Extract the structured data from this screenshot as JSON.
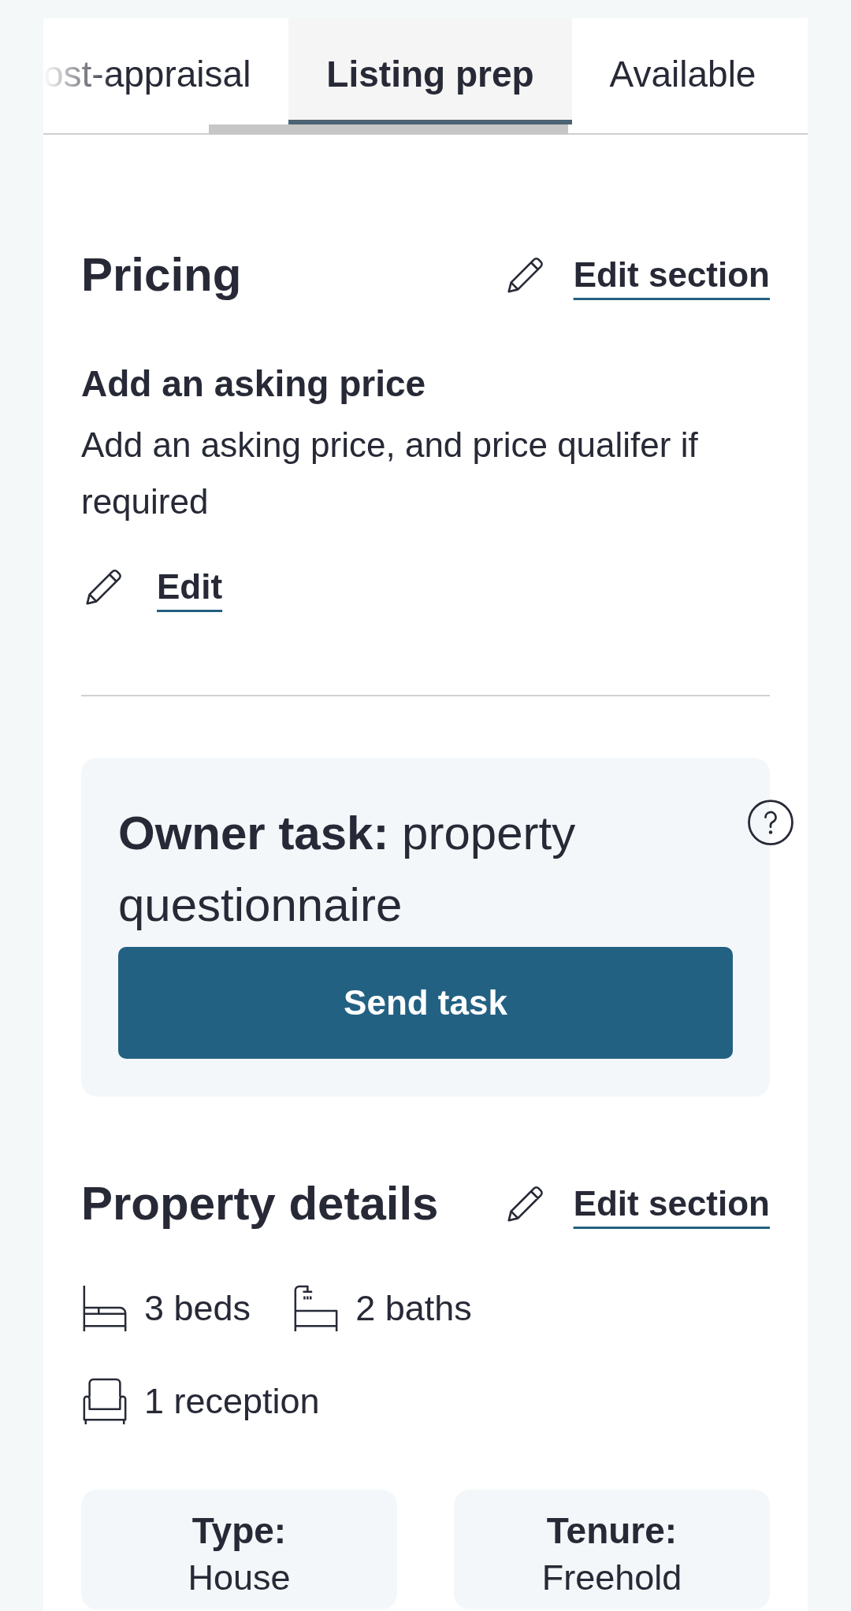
{
  "tabs": [
    {
      "label": "ost-appraisal",
      "selected": false
    },
    {
      "label": "Listing prep",
      "selected": true
    },
    {
      "label": "Available",
      "selected": false
    }
  ],
  "pricing": {
    "title": "Pricing",
    "edit_link": "Edit section",
    "items": [
      {
        "title": "Add an asking price",
        "description": "Add an asking price, and price qualifer if required",
        "action": "Edit"
      }
    ]
  },
  "owner_task": {
    "title": "**Owner task:** property questionnaire",
    "button": "Send task"
  },
  "property_details": {
    "title": "Property details",
    "edit_link": "Edit section",
    "features": [
      {
        "kind": "bed",
        "text": "3 beds"
      },
      {
        "kind": "bath",
        "text": "2 baths"
      },
      {
        "kind": "reception",
        "text": "1 reception"
      }
    ],
    "facts": [
      {
        "label": "Type:",
        "value": "House"
      },
      {
        "label": "Tenure:",
        "value": "Freehold"
      }
    ]
  }
}
